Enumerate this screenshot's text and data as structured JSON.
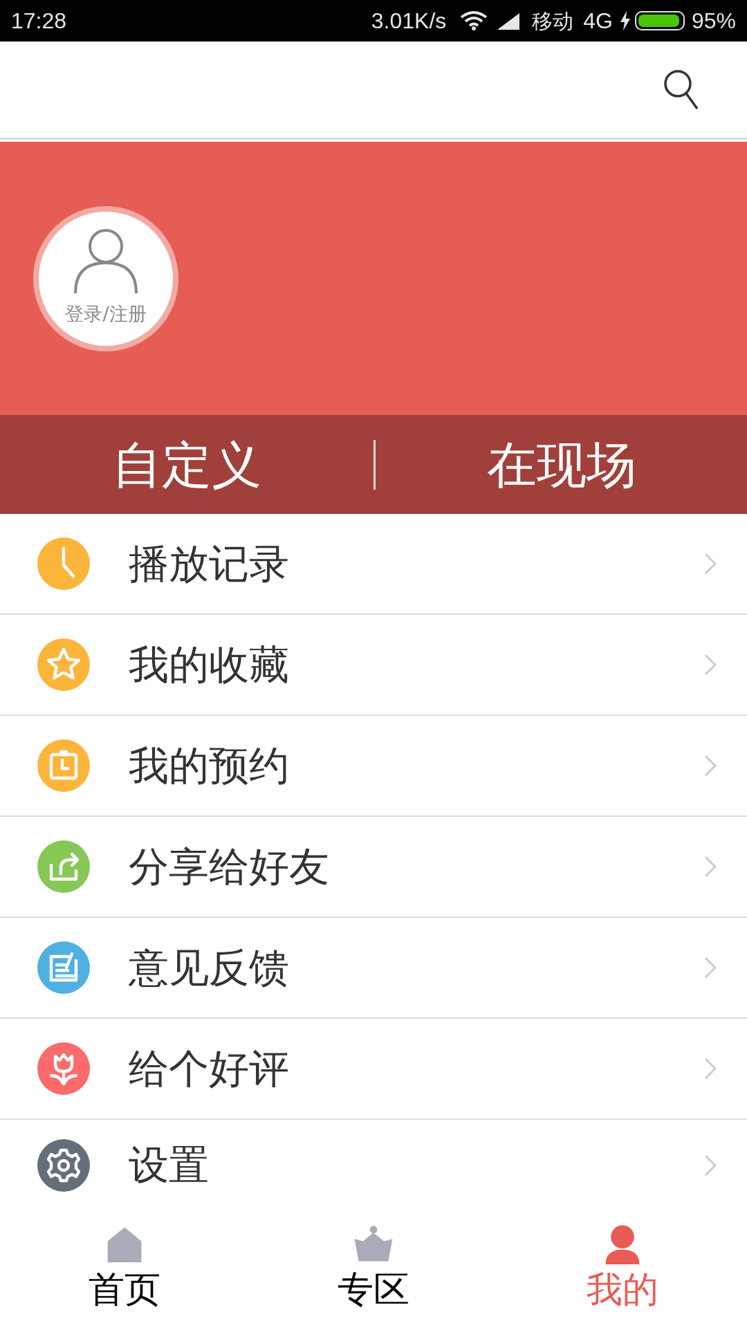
{
  "status_bar": {
    "time": "17:28",
    "speed": "3.01K/s",
    "carrier": "移动",
    "network": "4G",
    "battery": {
      "text": "95%",
      "level": 0.95
    }
  },
  "profile": {
    "login_label": "登录/注册"
  },
  "quick_links": [
    {
      "label": "自定义"
    },
    {
      "label": "在现场"
    }
  ],
  "menu": [
    {
      "kind": "clock",
      "label": "播放记录",
      "color": "#fcb53b"
    },
    {
      "kind": "star",
      "label": "我的收藏",
      "color": "#fcb53b"
    },
    {
      "kind": "calendar",
      "label": "我的预约",
      "color": "#fcb53b"
    },
    {
      "kind": "share",
      "label": "分享给好友",
      "color": "#86c756"
    },
    {
      "kind": "edit",
      "label": "意见反馈",
      "color": "#50b0e2"
    },
    {
      "kind": "flower",
      "label": "给个好评",
      "color": "#fb6b6c"
    },
    {
      "kind": "gear",
      "label": "设置",
      "color": "#656e7b"
    }
  ],
  "bottom_nav": [
    {
      "kind": "home",
      "label": "首页",
      "selected": false
    },
    {
      "kind": "crown",
      "label": "专区",
      "selected": false
    },
    {
      "kind": "person",
      "label": "我的",
      "selected": true
    }
  ]
}
